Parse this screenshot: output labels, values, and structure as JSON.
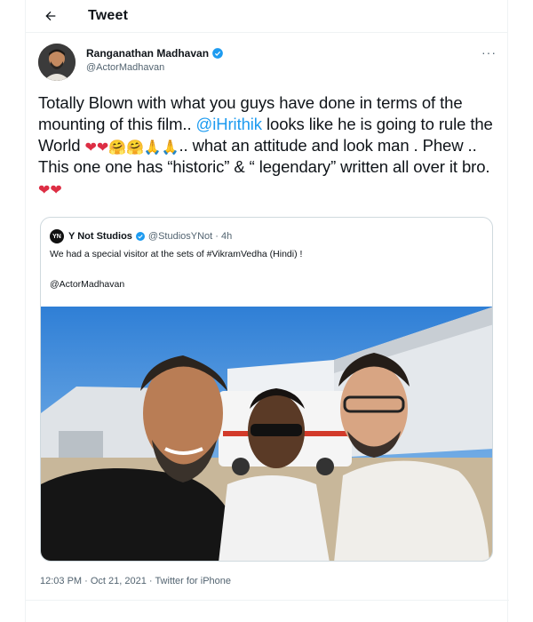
{
  "header": {
    "title": "Tweet",
    "back_icon": "arrow-left-icon"
  },
  "author": {
    "display_name": "Ranganathan Madhavan",
    "handle": "@ActorMadhavan",
    "verified_color": "#1d9bf0",
    "more_label": "···"
  },
  "tweet": {
    "part1": "Totally Blown with what you guys have done in terms of the mounting of this film.. ",
    "mention": "@iHrithik",
    "part2": "  looks like he is going to rule the World ",
    "part3": ".. what an attitude and look man . Phew .. This one one has “historic” & “ legendary” written all over it bro. ",
    "emoji_heart": "❤",
    "emoji_hug": "🤗",
    "emoji_pray": "🙏"
  },
  "quote": {
    "avatar_text": "YN",
    "display_name": "Y Not Studios",
    "handle_time": "@StudiosYNot · 4h",
    "text": "We had a special visitor at the sets of #VikramVedha (Hindi) !",
    "mention_line": "@ActorMadhavan"
  },
  "meta": {
    "timestamp": "12:03 PM · Oct 21, 2021",
    "separator": " · ",
    "source": "Twitter for iPhone"
  },
  "colors": {
    "accent": "#1d9bf0",
    "heart": "#dd2e44",
    "border": "#cfd9de"
  }
}
